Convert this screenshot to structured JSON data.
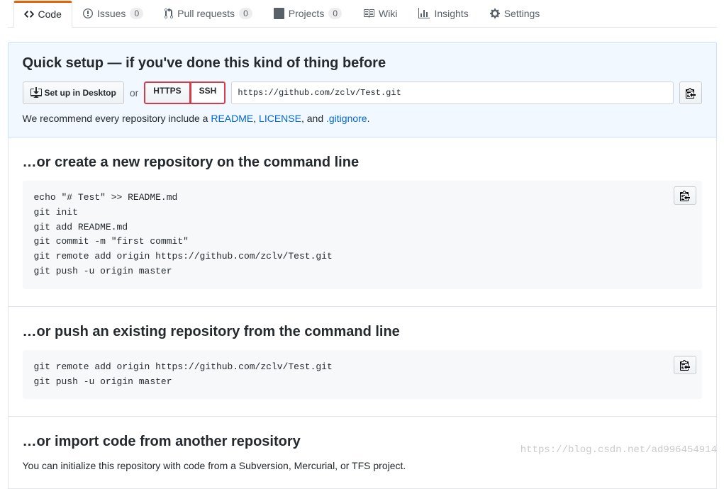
{
  "tabs": {
    "code": "Code",
    "issues": "Issues",
    "issues_count": "0",
    "pulls": "Pull requests",
    "pulls_count": "0",
    "projects": "Projects",
    "projects_count": "0",
    "wiki": "Wiki",
    "insights": "Insights",
    "settings": "Settings"
  },
  "setup": {
    "title": "Quick setup — if you've done this kind of thing before",
    "desktop_btn": "Set up in Desktop",
    "or": "or",
    "https": "HTTPS",
    "ssh": "SSH",
    "url": "https://github.com/zclv/Test.git",
    "recommend_prefix": "We recommend every repository include a ",
    "readme_link": "README",
    "comma1": ", ",
    "license_link": "LICENSE",
    "comma2": ", and ",
    "gitignore_link": ".gitignore",
    "period": "."
  },
  "create": {
    "title": "…or create a new repository on the command line",
    "code": "echo \"# Test\" >> README.md\ngit init\ngit add README.md\ngit commit -m \"first commit\"\ngit remote add origin https://github.com/zclv/Test.git\ngit push -u origin master"
  },
  "push": {
    "title": "…or push an existing repository from the command line",
    "code": "git remote add origin https://github.com/zclv/Test.git\ngit push -u origin master"
  },
  "import": {
    "title": "…or import code from another repository",
    "desc": "You can initialize this repository with code from a Subversion, Mercurial, or TFS project."
  },
  "watermark": "https://blog.csdn.net/ad996454914"
}
